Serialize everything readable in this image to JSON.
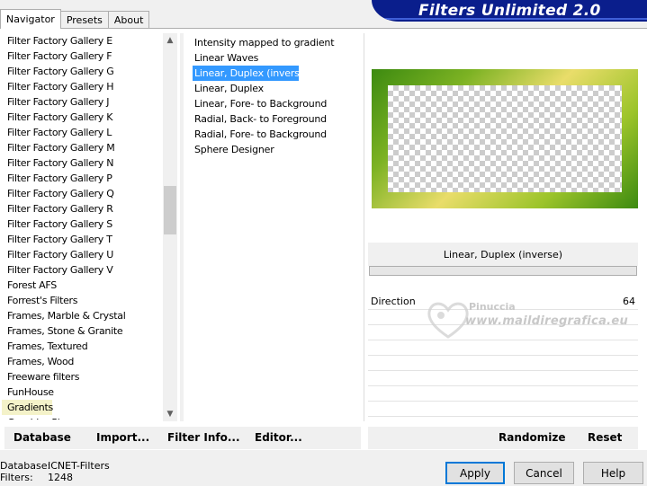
{
  "tabs": [
    "Navigator",
    "Presets",
    "About"
  ],
  "brand": "Filters Unlimited 2.0",
  "categories": [
    "Filter Factory Gallery E",
    "Filter Factory Gallery F",
    "Filter Factory Gallery G",
    "Filter Factory Gallery H",
    "Filter Factory Gallery J",
    "Filter Factory Gallery K",
    "Filter Factory Gallery L",
    "Filter Factory Gallery M",
    "Filter Factory Gallery N",
    "Filter Factory Gallery P",
    "Filter Factory Gallery Q",
    "Filter Factory Gallery R",
    "Filter Factory Gallery S",
    "Filter Factory Gallery T",
    "Filter Factory Gallery U",
    "Filter Factory Gallery V",
    "Forest AFS",
    "Forrest's Filters",
    "Frames, Marble & Crystal",
    "Frames, Stone & Granite",
    "Frames, Textured",
    "Frames, Wood",
    "Freeware filters",
    "FunHouse",
    "Gradients",
    "Graphics Plus"
  ],
  "selected_category": "Gradients",
  "filters": [
    "Intensity mapped to gradient",
    "Linear Waves",
    "Linear, Duplex (inverse)",
    "Linear, Duplex",
    "Linear, Fore- to Background",
    "Radial, Back- to Foreground",
    "Radial, Fore- to Background",
    "Sphere Designer"
  ],
  "selected_filter": "Linear, Duplex (inverse)",
  "current_filter_title": "Linear, Duplex (inverse)",
  "parameters": [
    {
      "label": "Direction",
      "value": "64"
    }
  ],
  "watermark": {
    "name": "Pinuccia",
    "url": "www.maildiregrafica.eu"
  },
  "toolbar_left": {
    "database": "Database",
    "import": "Import...",
    "filter_info": "Filter Info...",
    "editor": "Editor..."
  },
  "toolbar_right": {
    "randomize": "Randomize",
    "reset": "Reset"
  },
  "footer": {
    "database_label": "Database:",
    "database_value": "ICNET-Filters",
    "filters_label": "Filters:",
    "filters_value": "1248"
  },
  "buttons": {
    "apply": "Apply",
    "cancel": "Cancel",
    "help": "Help"
  },
  "colors": {
    "brand": "#0a1e8c",
    "selection": "#3399ff",
    "category_selection": "#f4f2c9"
  }
}
